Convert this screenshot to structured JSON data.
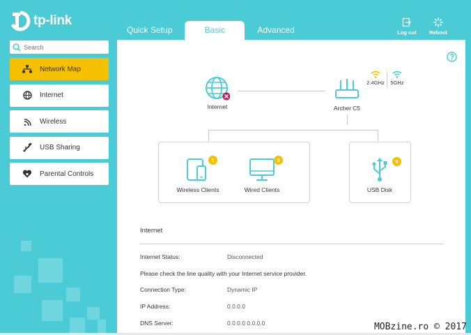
{
  "brand": {
    "name": "tp-link"
  },
  "tabs": [
    {
      "label": "Quick Setup"
    },
    {
      "label": "Basic"
    },
    {
      "label": "Advanced"
    }
  ],
  "actions": {
    "logout": "Log out",
    "reboot": "Reboot"
  },
  "search": {
    "placeholder": "Search"
  },
  "sidebar": {
    "items": [
      {
        "label": "Network Map",
        "icon": "network-map-icon"
      },
      {
        "label": "Internet",
        "icon": "globe-icon"
      },
      {
        "label": "Wireless",
        "icon": "wifi-icon"
      },
      {
        "label": "USB Sharing",
        "icon": "usb-icon"
      },
      {
        "label": "Parental Controls",
        "icon": "heart-icon"
      }
    ]
  },
  "map": {
    "internet_label": "Internet",
    "router_label": "Archer C5",
    "band_24": "2.4GHz",
    "band_5": "5GHz",
    "wireless_clients": {
      "label": "Wireless Clients",
      "count": "1"
    },
    "wired_clients": {
      "label": "Wired Clients",
      "count": "3"
    },
    "usb_disk": {
      "label": "USB Disk",
      "count": "0"
    }
  },
  "internet": {
    "title": "Internet",
    "status_label": "Internet Status:",
    "status_value": "Disconnected",
    "note": "Please check the line quality with your Internet service provider.",
    "conn_type_label": "Connection Type:",
    "conn_type_value": "Dynamic IP",
    "ip_label": "IP Address:",
    "ip_value": "0.0.0.0",
    "dns_label": "DNS Server:",
    "dns_value": "0.0.0.0 0.0.0.0"
  },
  "watermark": "MOBzine.ro © 2017",
  "colors": {
    "teal": "#4acbd6",
    "accent": "#f5c000",
    "error": "#c2185b"
  }
}
